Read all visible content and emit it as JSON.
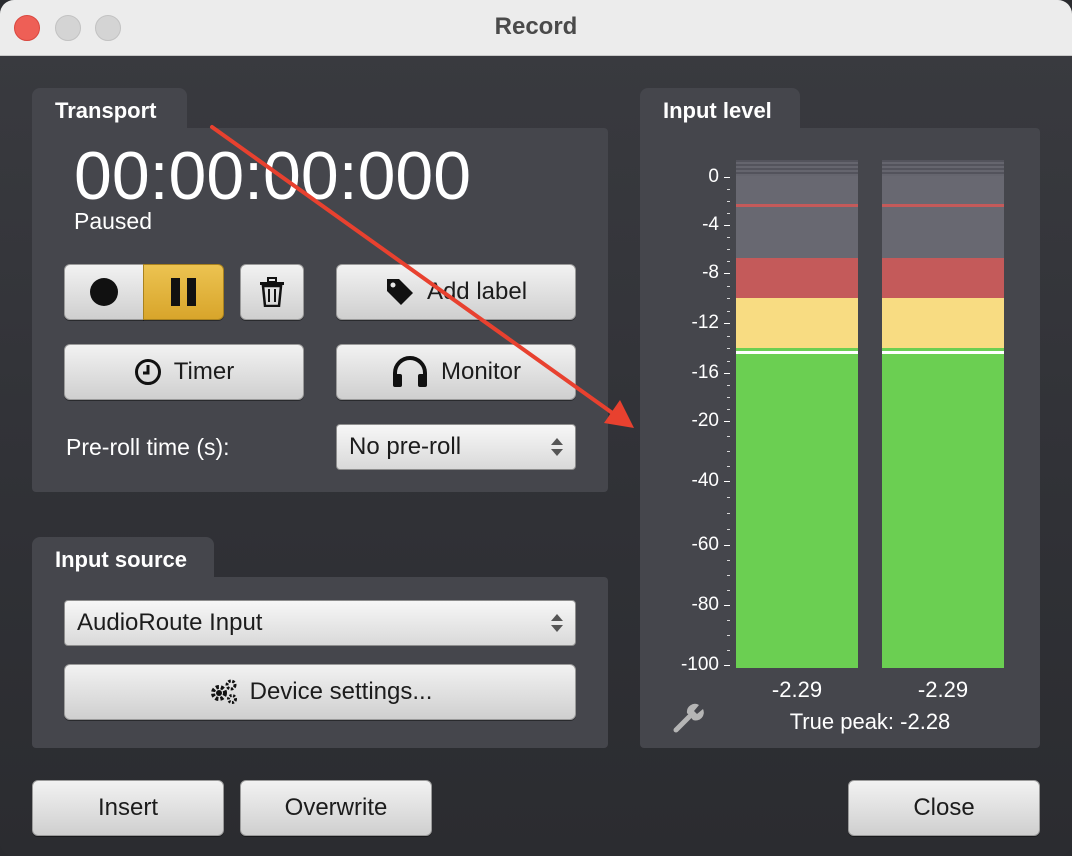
{
  "window": {
    "title": "Record"
  },
  "transport": {
    "tab_label": "Transport",
    "timecode": "00:00:00:000",
    "status": "Paused",
    "add_label": "Add label",
    "timer_label": "Timer",
    "monitor_label": "Monitor",
    "preroll_label": "Pre-roll time (s):",
    "preroll_value": "No pre-roll"
  },
  "input_source": {
    "tab_label": "Input source",
    "device": "AudioRoute Input",
    "device_settings_label": "Device settings..."
  },
  "input_level": {
    "tab_label": "Input level",
    "scale": [
      "0",
      "-4",
      "-8",
      "-12",
      "-16",
      "-20",
      "-40",
      "-60",
      "-80",
      "-100"
    ],
    "left_peak": "-2.29",
    "right_peak": "-2.29",
    "true_peak": "True peak: -2.28",
    "colors": {
      "green": "#6bcf52",
      "yellow": "#f8dc82",
      "red": "#c45a5a",
      "grey": "#686871"
    }
  },
  "footer": {
    "insert_label": "Insert",
    "overwrite_label": "Overwrite",
    "close_label": "Close"
  },
  "annotation": {
    "color": "#e8412f"
  }
}
